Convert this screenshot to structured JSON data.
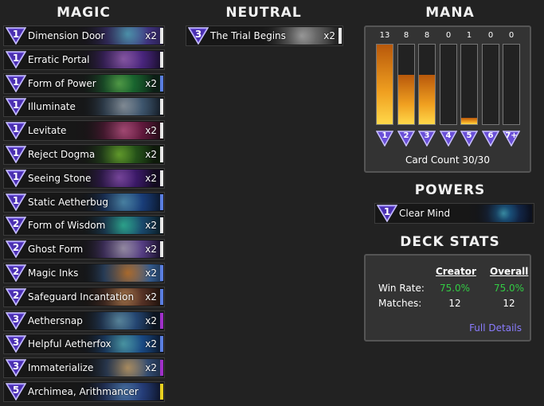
{
  "columns": {
    "magic": "MAGIC",
    "neutral": "NEUTRAL",
    "mana": "MANA",
    "powers": "POWERS",
    "deck_stats": "DECK STATS"
  },
  "magic_cards": [
    {
      "cost": "1",
      "name": "Dimension Door",
      "count": "x2",
      "bar": "#e8e8e8"
    },
    {
      "cost": "1",
      "name": "Erratic Portal",
      "count": "",
      "bar": "#e8e8e8"
    },
    {
      "cost": "1",
      "name": "Form of Power",
      "count": "x2",
      "bar": "#5a7ee0"
    },
    {
      "cost": "1",
      "name": "Illuminate",
      "count": "",
      "bar": "#e8e8e8"
    },
    {
      "cost": "1",
      "name": "Levitate",
      "count": "x2",
      "bar": "#e8e8e8"
    },
    {
      "cost": "1",
      "name": "Reject Dogma",
      "count": "x2",
      "bar": "#e8e8e8"
    },
    {
      "cost": "1",
      "name": "Seeing Stone",
      "count": "x2",
      "bar": "#e8e8e8"
    },
    {
      "cost": "1",
      "name": "Static Aetherbug",
      "count": "",
      "bar": "#5a7ee0"
    },
    {
      "cost": "2",
      "name": "Form of Wisdom",
      "count": "x2",
      "bar": "#e8e8e8"
    },
    {
      "cost": "2",
      "name": "Ghost Form",
      "count": "x2",
      "bar": "#e8e8e8"
    },
    {
      "cost": "2",
      "name": "Magic Inks",
      "count": "x2",
      "bar": "#5a7ee0"
    },
    {
      "cost": "2",
      "name": "Safeguard Incantation",
      "count": "x2",
      "bar": "#5a7ee0"
    },
    {
      "cost": "3",
      "name": "Aethersnap",
      "count": "x2",
      "bar": "#a030c8"
    },
    {
      "cost": "3",
      "name": "Helpful Aetherfox",
      "count": "x2",
      "bar": "#5a7ee0"
    },
    {
      "cost": "3",
      "name": "Immaterialize",
      "count": "x2",
      "bar": "#a030c8"
    },
    {
      "cost": "5",
      "name": "Archimea, Arithmancer",
      "count": "",
      "bar": "#e8d020"
    }
  ],
  "neutral_cards": [
    {
      "cost": "3",
      "name": "The Trial Begins",
      "count": "x2",
      "bar": "#e8e8e8"
    }
  ],
  "mana_curve": [
    {
      "cost": "1",
      "count": 13
    },
    {
      "cost": "2",
      "count": 8
    },
    {
      "cost": "3",
      "count": 8
    },
    {
      "cost": "4",
      "count": 0
    },
    {
      "cost": "5",
      "count": 1
    },
    {
      "cost": "6",
      "count": 0
    },
    {
      "cost": "7+",
      "count": 0
    }
  ],
  "mana_max": 13,
  "card_count": "Card Count 30/30",
  "power": {
    "cost": "1",
    "name": "Clear Mind"
  },
  "stats": {
    "col_creator": "Creator",
    "col_overall": "Overall",
    "win_rate_label": "Win Rate:",
    "matches_label": "Matches:",
    "creator_win_rate": "75.0%",
    "overall_win_rate": "75.0%",
    "creator_matches": "12",
    "overall_matches": "12",
    "full_details": "Full Details"
  },
  "colors": {
    "win_green": "#33cc44",
    "link_purple": "#8a7cff",
    "gem_purple": "#6a4fd8",
    "mana_orange": "#f0a020"
  }
}
